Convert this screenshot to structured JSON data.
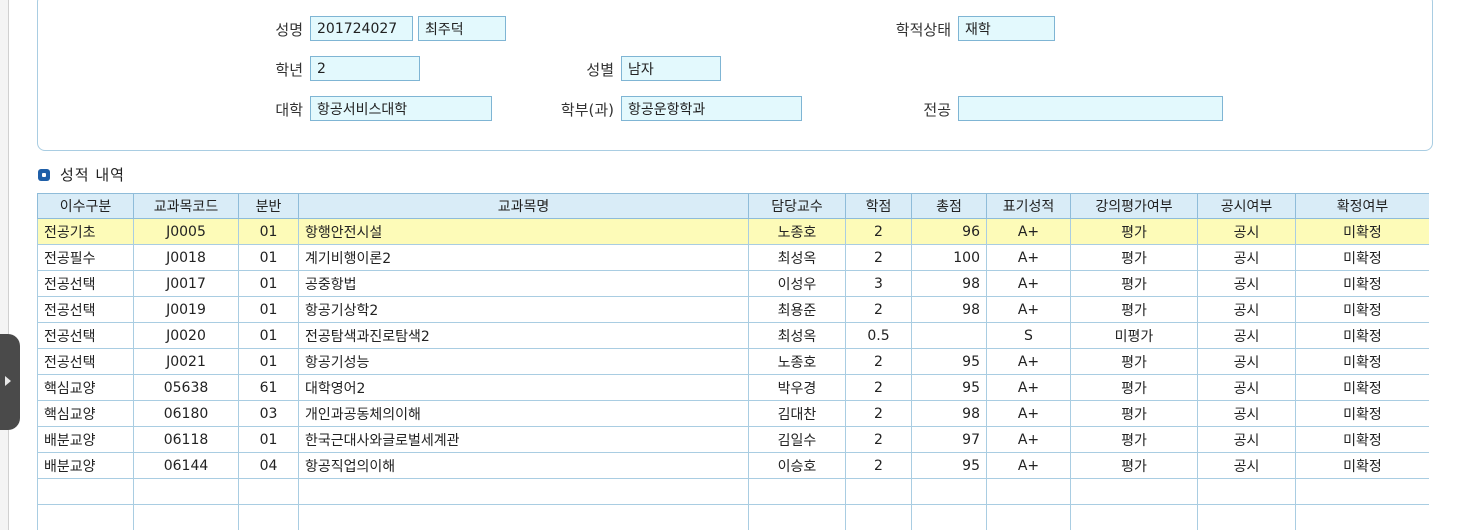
{
  "student": {
    "name_label": "성명",
    "student_id": "201724027",
    "student_name": "최주덕",
    "status_label": "학적상태",
    "status_value": "재학",
    "year_label": "학년",
    "year_value": "2",
    "gender_label": "성별",
    "gender_value": "남자",
    "college_label": "대학",
    "college_value": "항공서비스대학",
    "dept_label": "학부(과)",
    "dept_value": "항공운항학과",
    "major_label": "전공",
    "major_value": ""
  },
  "section": {
    "title": "성적 내역"
  },
  "grid": {
    "columns": [
      "이수구분",
      "교과목코드",
      "분반",
      "교과목명",
      "담당교수",
      "학점",
      "총점",
      "표기성적",
      "강의평가여부",
      "공시여부",
      "확정여부"
    ],
    "rows": [
      {
        "type": "전공기초",
        "code": "J0005",
        "section": "01",
        "name": "항행안전시설",
        "professor": "노종호",
        "credit": "2",
        "score": "96",
        "grade": "A+",
        "evaluation": "평가",
        "disclosure": "공시",
        "confirmed": "미확정"
      },
      {
        "type": "전공필수",
        "code": "J0018",
        "section": "01",
        "name": "계기비행이론2",
        "professor": "최성옥",
        "credit": "2",
        "score": "100",
        "grade": "A+",
        "evaluation": "평가",
        "disclosure": "공시",
        "confirmed": "미확정"
      },
      {
        "type": "전공선택",
        "code": "J0017",
        "section": "01",
        "name": "공중항법",
        "professor": "이성우",
        "credit": "3",
        "score": "98",
        "grade": "A+",
        "evaluation": "평가",
        "disclosure": "공시",
        "confirmed": "미확정"
      },
      {
        "type": "전공선택",
        "code": "J0019",
        "section": "01",
        "name": "항공기상학2",
        "professor": "최용준",
        "credit": "2",
        "score": "98",
        "grade": "A+",
        "evaluation": "평가",
        "disclosure": "공시",
        "confirmed": "미확정"
      },
      {
        "type": "전공선택",
        "code": "J0020",
        "section": "01",
        "name": "전공탐색과진로탐색2",
        "professor": "최성옥",
        "credit": "0.5",
        "score": "",
        "grade": "S",
        "evaluation": "미평가",
        "disclosure": "공시",
        "confirmed": "미확정"
      },
      {
        "type": "전공선택",
        "code": "J0021",
        "section": "01",
        "name": "항공기성능",
        "professor": "노종호",
        "credit": "2",
        "score": "95",
        "grade": "A+",
        "evaluation": "평가",
        "disclosure": "공시",
        "confirmed": "미확정"
      },
      {
        "type": "핵심교양",
        "code": "05638",
        "section": "61",
        "name": "대학영어2",
        "professor": "박우경",
        "credit": "2",
        "score": "95",
        "grade": "A+",
        "evaluation": "평가",
        "disclosure": "공시",
        "confirmed": "미확정"
      },
      {
        "type": "핵심교양",
        "code": "06180",
        "section": "03",
        "name": "개인과공동체의이해",
        "professor": "김대찬",
        "credit": "2",
        "score": "98",
        "grade": "A+",
        "evaluation": "평가",
        "disclosure": "공시",
        "confirmed": "미확정"
      },
      {
        "type": "배분교양",
        "code": "06118",
        "section": "01",
        "name": "한국근대사와글로벌세계관",
        "professor": "김일수",
        "credit": "2",
        "score": "97",
        "grade": "A+",
        "evaluation": "평가",
        "disclosure": "공시",
        "confirmed": "미확정"
      },
      {
        "type": "배분교양",
        "code": "06144",
        "section": "04",
        "name": "항공직업의이해",
        "professor": "이승호",
        "credit": "2",
        "score": "95",
        "grade": "A+",
        "evaluation": "평가",
        "disclosure": "공시",
        "confirmed": "미확정"
      },
      {
        "type": "",
        "code": "",
        "section": "",
        "name": "",
        "professor": "",
        "credit": "",
        "score": "",
        "grade": "",
        "evaluation": "",
        "disclosure": "",
        "confirmed": ""
      },
      {
        "type": "",
        "code": "",
        "section": "",
        "name": "",
        "professor": "",
        "credit": "",
        "score": "",
        "grade": "",
        "evaluation": "",
        "disclosure": "",
        "confirmed": ""
      }
    ]
  },
  "colors": {
    "field_bg": "#e3f9fd",
    "header_bg": "#d9ecf7",
    "selected_row": "#fdfbb8",
    "border": "#a9cde2"
  }
}
